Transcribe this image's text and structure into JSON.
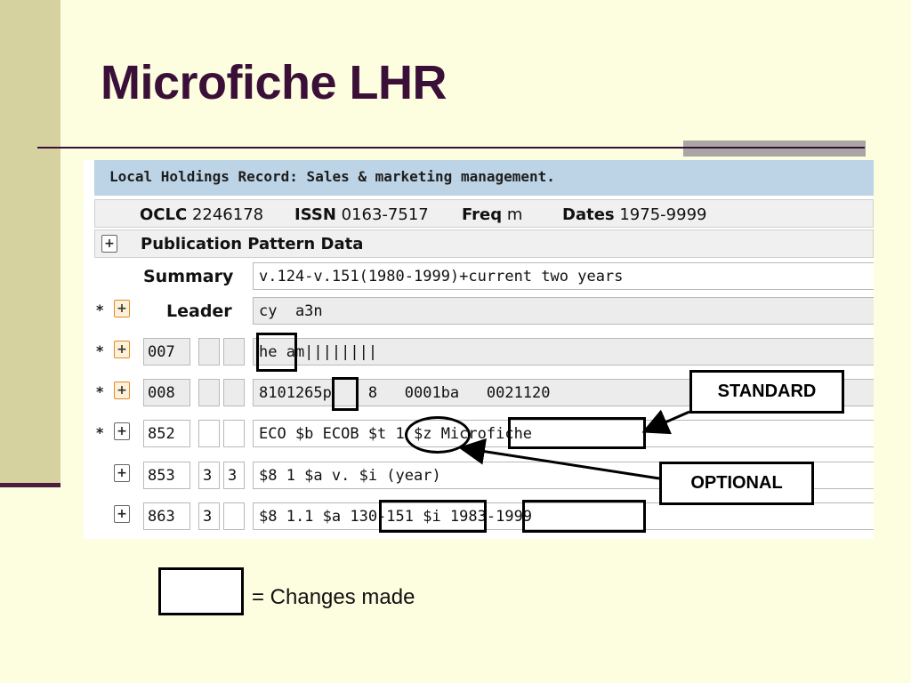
{
  "slide": {
    "title": "Microfiche LHR"
  },
  "record": {
    "header": "Local Holdings Record: Sales & marketing management.",
    "info": {
      "oclc_label": "OCLC",
      "oclc_value": "2246178",
      "issn_label": "ISSN",
      "issn_value": "0163-7517",
      "freq_label": "Freq",
      "freq_value": "m",
      "dates_label": "Dates",
      "dates_value": "1975-9999"
    },
    "pattern_label": "Publication Pattern Data",
    "summary_label": "Summary",
    "summary_value": "v.124-v.151(1980-1999)+current two years",
    "leader_label": "Leader",
    "leader_value": "cy  a3n",
    "rows": [
      {
        "tag": "007",
        "ind1": "",
        "ind2": "",
        "value": "he am||||||||",
        "starred": "*"
      },
      {
        "tag": "008",
        "ind1": "",
        "ind2": "",
        "value": "8101265p    8   0001ba   0021120",
        "starred": "*"
      },
      {
        "tag": "852",
        "ind1": "",
        "ind2": "",
        "value": "ECO $b ECOB $t 1 $z Microfiche",
        "starred": "*"
      },
      {
        "tag": "853",
        "ind1": "3",
        "ind2": "3",
        "value": "$8 1 $a v. $i (year)",
        "starred": ""
      },
      {
        "tag": "863",
        "ind1": "3",
        "ind2": "",
        "value": "$8 1.1 $a 130-151 $i 1983-1999",
        "starred": ""
      }
    ],
    "plus_glyph": "+"
  },
  "callouts": {
    "standard": "STANDARD",
    "optional": "OPTIONAL"
  },
  "legend": {
    "text": "= Changes made"
  }
}
